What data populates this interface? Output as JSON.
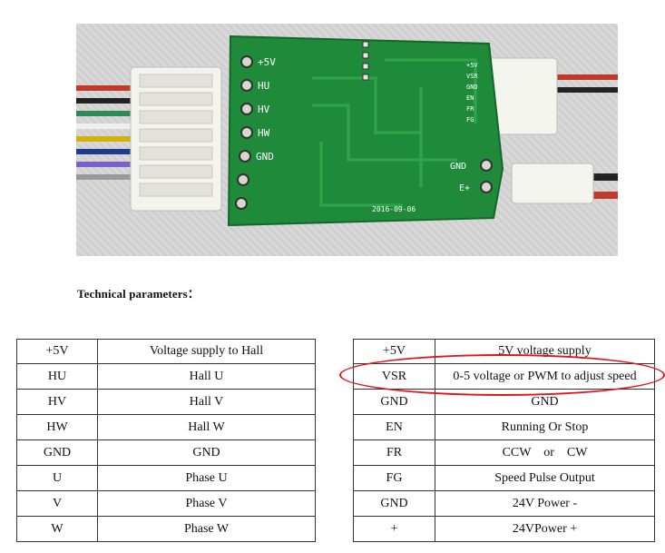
{
  "photo": {
    "left_pins": [
      "+5V",
      "HU",
      "HV",
      "HW",
      "GND"
    ],
    "right_pins": [
      "+5V",
      "VSR",
      "GND",
      "EN",
      "FR",
      "FG"
    ],
    "power_labels": [
      "GND",
      "E+"
    ],
    "silkscreen_date": "2016-09-06"
  },
  "title": "Technical parameters：",
  "left_table": [
    {
      "pin": "+5V",
      "desc": "Voltage supply to Hall"
    },
    {
      "pin": "HU",
      "desc": "Hall U"
    },
    {
      "pin": "HV",
      "desc": "Hall V"
    },
    {
      "pin": "HW",
      "desc": "Hall W"
    },
    {
      "pin": "GND",
      "desc": "GND"
    },
    {
      "pin": "U",
      "desc": "Phase U"
    },
    {
      "pin": "V",
      "desc": "Phase V"
    },
    {
      "pin": "W",
      "desc": "Phase W"
    }
  ],
  "right_table": [
    {
      "pin": "+5V",
      "desc": "5V voltage supply"
    },
    {
      "pin": "VSR",
      "desc": "0-5 voltage or PWM to adjust speed"
    },
    {
      "pin": "GND",
      "desc": "GND"
    },
    {
      "pin": "EN",
      "desc": "Running Or Stop"
    },
    {
      "pin": "FR",
      "desc": "CCW    or    CW"
    },
    {
      "pin": "FG",
      "desc": "Speed Pulse Output"
    },
    {
      "pin": "GND",
      "desc": "24V Power -"
    },
    {
      "pin": "+",
      "desc": "24VPower +"
    }
  ],
  "colors": {
    "pcb": "#1f8a3a",
    "highlight": "#e0161c",
    "connector": "#f4f4ee"
  }
}
